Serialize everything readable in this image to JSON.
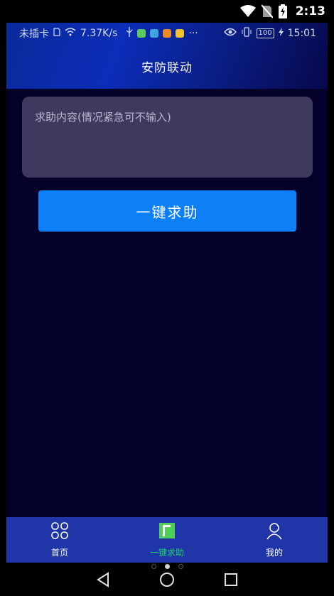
{
  "outer_status": {
    "time": "2:13",
    "icons": [
      "wifi-icon",
      "no-sim-icon",
      "battery-charging-icon"
    ]
  },
  "inner_status": {
    "left_text": "未插卡",
    "speed": "7.37K/s",
    "battery_level": "100",
    "time": "15:01"
  },
  "header": {
    "title": "安防联动"
  },
  "help_form": {
    "placeholder": "求助内容(情况紧急可不输入)",
    "button_label": "一键求助"
  },
  "bottom_nav": {
    "items": [
      {
        "label": "首页",
        "icon": "home-grid-icon",
        "active": false
      },
      {
        "label": "一键求助",
        "icon": "help-card-icon",
        "active": true
      },
      {
        "label": "我的",
        "icon": "user-icon",
        "active": false
      }
    ]
  },
  "colors": {
    "background": "#03002a",
    "header_gradient_start": "#0b2db8",
    "input_bg": "#3d3a5e",
    "button_bg": "#0d7ff7",
    "nav_bg": "#1f35a8",
    "active_tab": "#1fd16f"
  }
}
